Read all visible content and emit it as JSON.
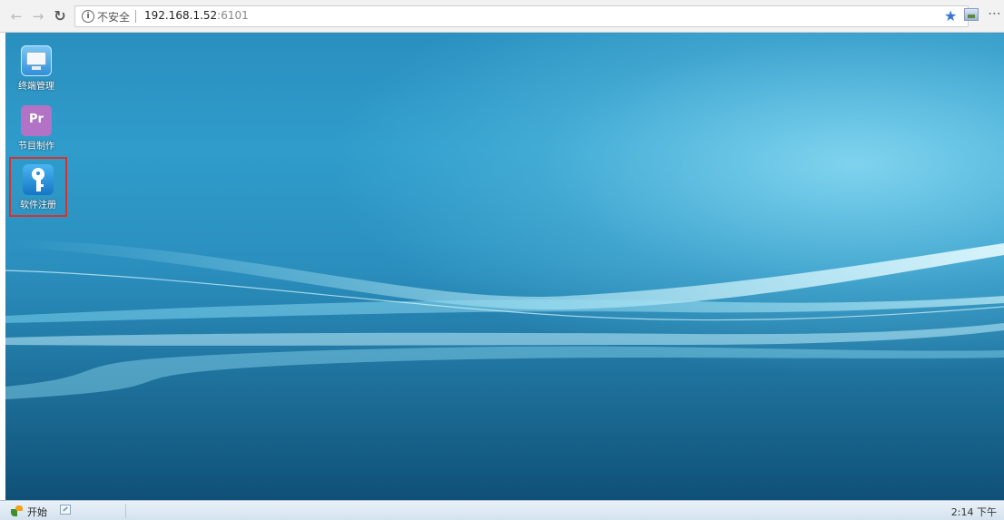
{
  "browser": {
    "nav": {
      "back_icon": "back-arrow-icon",
      "forward_icon": "forward-arrow-icon",
      "reload_icon": "reload-icon"
    },
    "omnibox": {
      "security_label": "不安全",
      "url_host": "192.168.1.52",
      "url_port": ":6101"
    },
    "toolbar_icons": [
      "star-icon",
      "extension-icon",
      "menu-icon"
    ]
  },
  "desktop": {
    "icons": [
      {
        "label": "终端管理",
        "icon": "monitor-icon"
      },
      {
        "label": "节目制作",
        "icon": "premiere-icon",
        "glyph": "Pr"
      },
      {
        "label": "软件注册",
        "icon": "key-icon",
        "highlighted": true
      }
    ],
    "highlight_color": "#d8322d"
  },
  "taskbar": {
    "start_label": "开始",
    "clock": "2:14 下午"
  },
  "colors": {
    "accent_star": "#3a74d8",
    "desktop_blue": "#2a8fbf"
  }
}
